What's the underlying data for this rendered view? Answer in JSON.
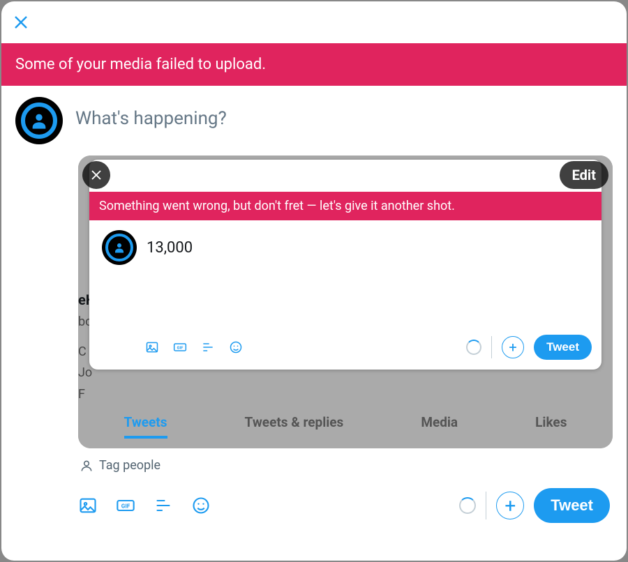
{
  "outer": {
    "error": "Some of your media failed to upload.",
    "placeholder": "What's happening?",
    "tag_people": "Tag people",
    "tweet_label": "Tweet"
  },
  "inner": {
    "error": "Something went wrong, but don't fret — let's give it another shot.",
    "text": "13,000",
    "tweet_label": "Tweet",
    "edit_label": "Edit"
  },
  "bg_tabs": {
    "tweets": "Tweets",
    "replies": "Tweets & replies",
    "media": "Media",
    "likes": "Likes"
  },
  "bg_profile": {
    "name_frag": "eH",
    "handle_frag": "bo",
    "c": "C",
    "jo": "Jo",
    "f": "F"
  }
}
